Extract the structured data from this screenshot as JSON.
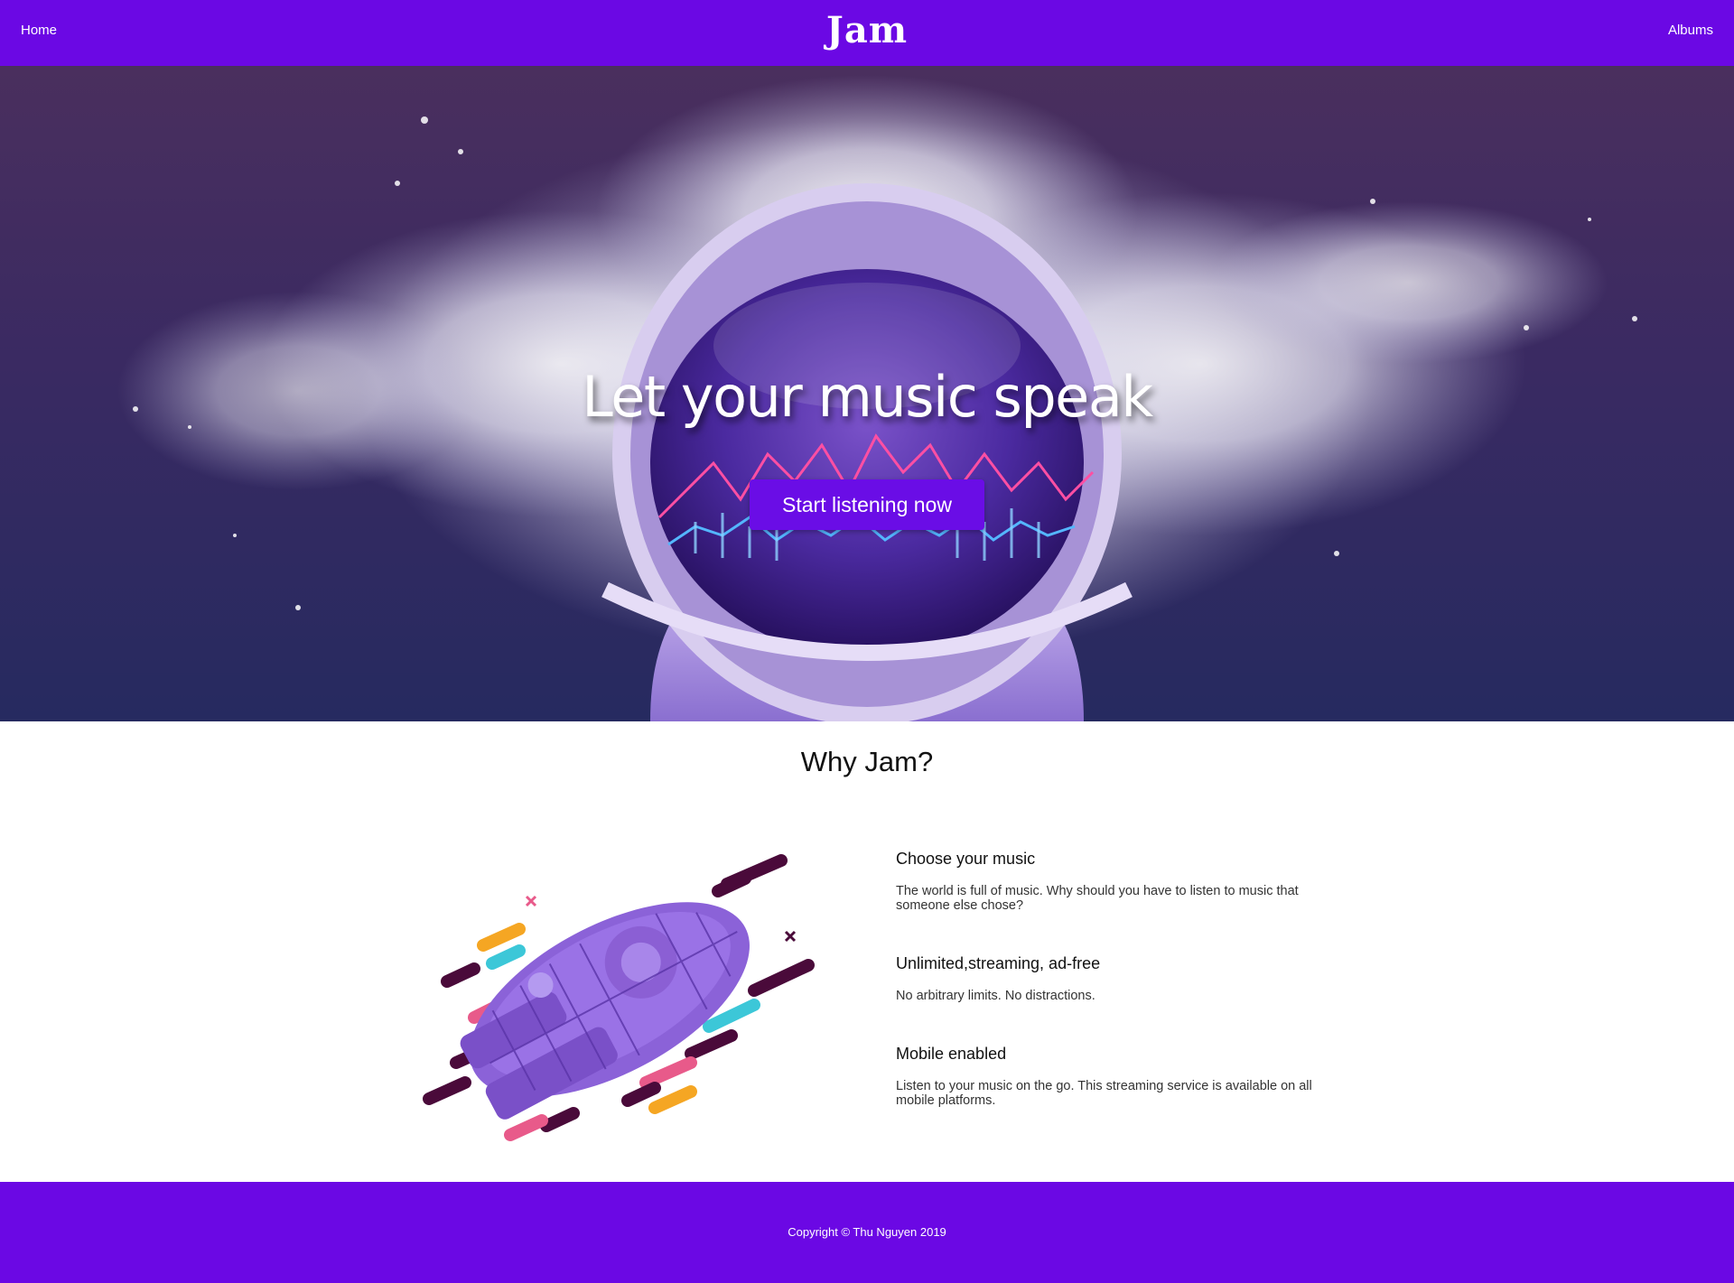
{
  "navbar": {
    "home_label": "Home",
    "logo_text": "Jam",
    "albums_label": "Albums",
    "background_color": "#6b08e4"
  },
  "hero": {
    "title": "Let your music speak",
    "cta_label": "Start listening now",
    "cta_color": "#6a0de6"
  },
  "why": {
    "title": "Why Jam?",
    "features": [
      {
        "heading": "Choose your music",
        "description": "The world is full of music. Why should you have to listen to music that someone else chose?"
      },
      {
        "heading": "Unlimited,streaming, ad-free",
        "description": "No arbitrary limits. No distractions."
      },
      {
        "heading": "Mobile enabled",
        "description": "Listen to your music on the go. This streaming service is available on all mobile platforms."
      }
    ]
  },
  "footer": {
    "copyright": "Copyright © Thu Nguyen 2019",
    "background_color": "#6b08e4"
  },
  "icons": [
    "astronaut-helmet-image",
    "purple-spaceship-image"
  ]
}
